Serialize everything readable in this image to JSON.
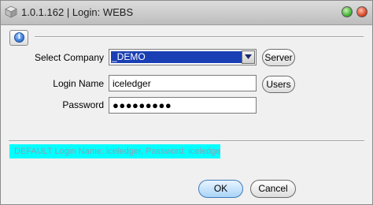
{
  "window": {
    "title": "1.0.1.162 | Login: WEBS"
  },
  "toolbar": {
    "info_icon": "info-icon"
  },
  "form": {
    "company_label": "Select Company",
    "company_value": "_DEMO",
    "server_button": "Server",
    "login_label": "Login Name",
    "login_value": "iceledger",
    "users_button": "Users",
    "password_label": "Password",
    "password_value": "●●●●●●●●●"
  },
  "hint": {
    "text": "DEFAULT Login Name: iceledger, Password: iceledger",
    "background": "#00ffff"
  },
  "actions": {
    "ok": "OK",
    "cancel": "Cancel"
  },
  "colors": {
    "selection": "#1a3fb4",
    "ok_accent": "#a9d4f7"
  }
}
